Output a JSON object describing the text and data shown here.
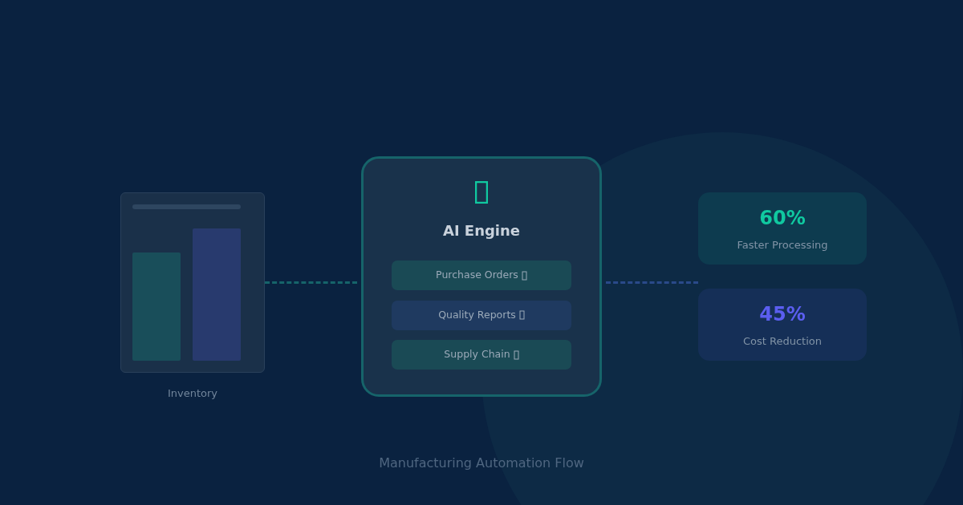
{
  "source": {
    "label": "Inventory"
  },
  "engine": {
    "title": "AI Engine",
    "items": [
      {
        "label": "Purchase Orders",
        "color": "#1a4a55"
      },
      {
        "label": "Quality Reports",
        "color": "#1f3a60"
      },
      {
        "label": "Supply Chain",
        "color": "#1a4a55"
      }
    ]
  },
  "stats": [
    {
      "value": "60%",
      "label": "Faster Processing",
      "color": "#10c9a0"
    },
    {
      "value": "45%",
      "label": "Cost Reduction",
      "color": "#5b5ef0"
    }
  ],
  "caption": "Manufacturing Automation Flow"
}
